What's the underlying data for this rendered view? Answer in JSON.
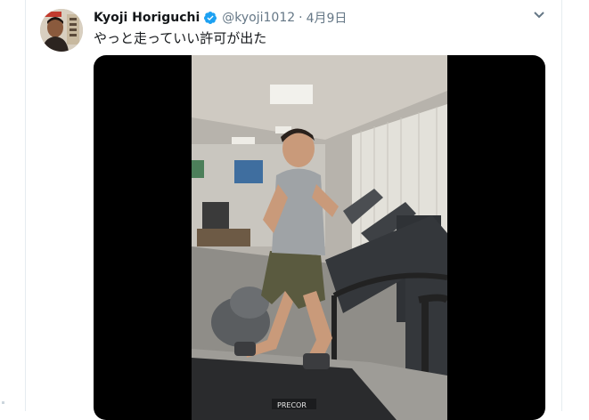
{
  "tweet": {
    "author_name": "Kyoji Horiguchi",
    "handle": "@kyoji1012",
    "separator": "·",
    "date": "4月9日",
    "text": "やっと走っていい許可が出た"
  },
  "icons": {
    "verified": "verified-badge-icon",
    "menu": "chevron-down-icon"
  },
  "media": {
    "brand_label": "PRECOR"
  },
  "colors": {
    "verified_blue": "#1da1f2",
    "secondary_text": "#657786",
    "primary_text": "#14171a",
    "media_background": "#000000"
  }
}
